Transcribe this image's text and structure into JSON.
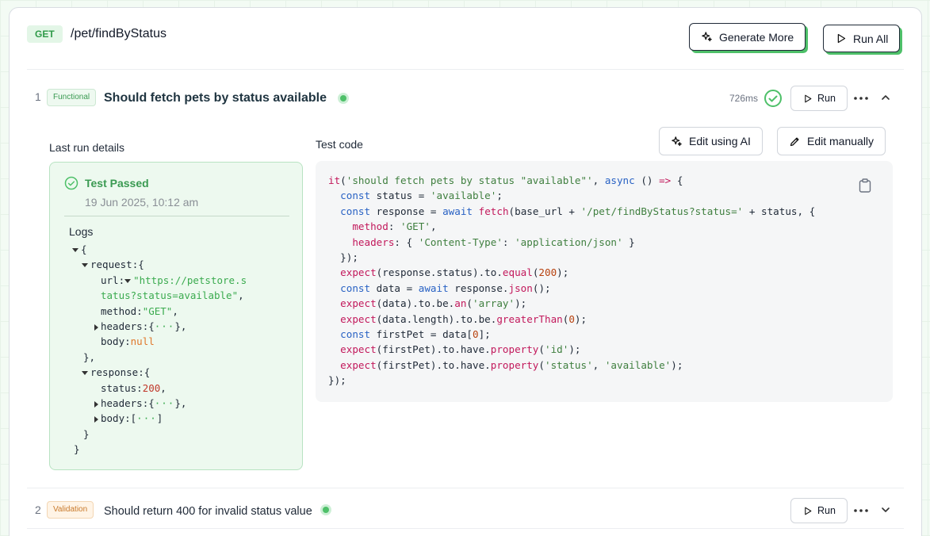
{
  "header": {
    "method": "GET",
    "endpoint": "/pet/findByStatus",
    "generate_label": "Generate More",
    "runall_label": "Run All"
  },
  "tests": [
    {
      "index": "1",
      "tag": "Functional",
      "title": "Should fetch pets by status available",
      "duration": "726ms",
      "run_label": "Run"
    },
    {
      "index": "2",
      "tag": "Validation",
      "title": "Should return 400 for invalid status value",
      "run_label": "Run"
    }
  ],
  "details": {
    "last_run_label": "Last run details",
    "test_code_label": "Test code",
    "edit_ai_label": "Edit using AI",
    "edit_manual_label": "Edit manually",
    "pass_title": "Test Passed",
    "pass_time": "19 Jun 2025, 10:12 am",
    "logs_label": "Logs"
  },
  "logs": {
    "open": "{",
    "request_key": "request",
    "url_key": "url",
    "url_value_1": "\"https://petstore.s",
    "url_value_2": "tatus?status=available\"",
    "method_key": "method",
    "method_value": "\"GET\"",
    "headers_key": "headers",
    "body_key": "body",
    "body_value": "null",
    "response_key": "response",
    "status_key": "status",
    "status_value": "200",
    "ellipsis": "···"
  },
  "colors": {
    "accent": "#4ec069",
    "pass_text": "#3a9a52",
    "functional_tag": "#3a9a52",
    "validation_tag": "#c8792a"
  },
  "icons": {
    "generate": "sparkle-icon",
    "run": "play-icon",
    "passed": "check-circle-icon",
    "more": "more-horizontal-icon",
    "expand": "chevron-up-icon",
    "collapse": "chevron-down-icon",
    "edit_ai": "sparkle-icon",
    "edit_manual": "pencil-icon",
    "copy": "clipboard-icon"
  }
}
